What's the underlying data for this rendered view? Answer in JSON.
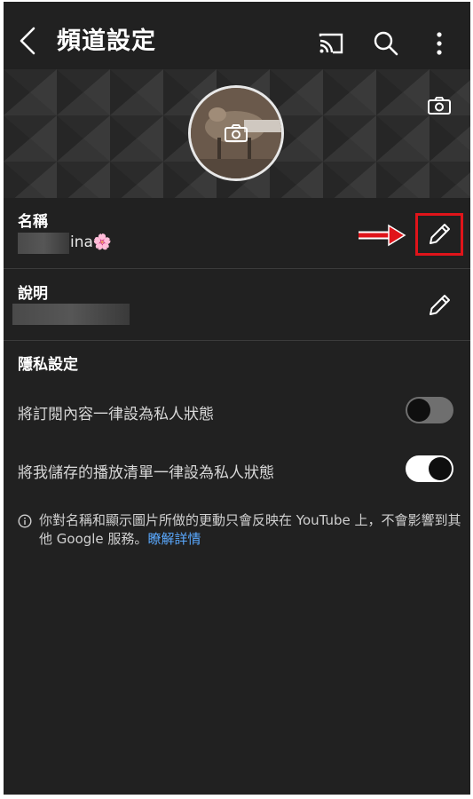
{
  "header": {
    "title": "頻道設定"
  },
  "name_section": {
    "label": "名稱",
    "value_visible": "ina",
    "emoji": "🌸"
  },
  "description_section": {
    "label": "說明"
  },
  "privacy": {
    "heading": "隱私設定",
    "toggles": [
      {
        "label": "將訂閱內容一律設為私人狀態",
        "on": false
      },
      {
        "label": "將我儲存的播放清單一律設為私人狀態",
        "on": true
      }
    ]
  },
  "info": {
    "text": "你對名稱和顯示圖片所做的更動只會反映在 YouTube 上，不會影響到其他 Google 服務。",
    "link": "瞭解詳情"
  },
  "colors": {
    "background": "#212121",
    "highlight": "#e0141a",
    "link": "#5aa9ff"
  }
}
